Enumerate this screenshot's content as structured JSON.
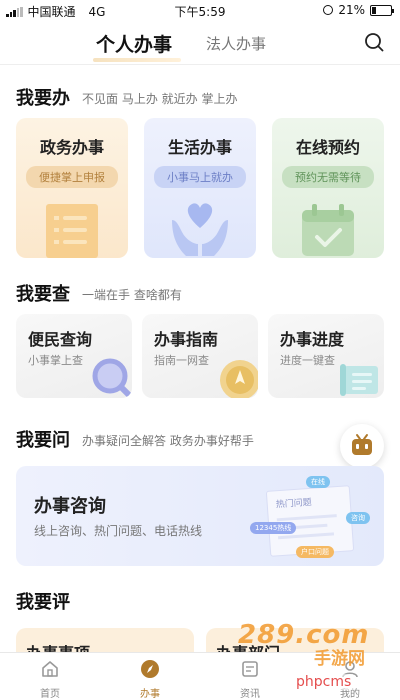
{
  "status_bar": {
    "carrier": "中国联通",
    "network": "4G",
    "time": "下午5:59",
    "battery": "21%",
    "battery_level": 0.21
  },
  "header": {
    "tab_active": "个人办事",
    "tab_other": "法人办事"
  },
  "section1": {
    "title": "我要办",
    "subtitle": "不见面 马上办 就近办 掌上办",
    "cards": [
      {
        "title": "政务办事",
        "pill": "便捷掌上申报"
      },
      {
        "title": "生活办事",
        "pill": "小事马上就办"
      },
      {
        "title": "在线预约",
        "pill": "预约无需等待"
      }
    ]
  },
  "section2": {
    "title": "我要查",
    "subtitle": "一端在手 查啥都有",
    "cards": [
      {
        "title": "便民查询",
        "sub": "小事掌上查"
      },
      {
        "title": "办事指南",
        "sub": "指南一网查"
      },
      {
        "title": "办事进度",
        "sub": "进度一键查"
      }
    ]
  },
  "section3": {
    "title": "我要问",
    "subtitle": "办事疑问全解答 政务办事好帮手",
    "banner": {
      "title": "办事咨询",
      "sub": "线上咨询、热门问题、电话热线",
      "doc_label": "热门问题",
      "tag1": "在线",
      "tag2": "咨询",
      "tag3": "12345热线",
      "tag4": "户口问题"
    }
  },
  "section4": {
    "title": "我要评",
    "cards": [
      {
        "title": "办事事项"
      },
      {
        "title": "办事部门"
      }
    ]
  },
  "nav": {
    "items": [
      {
        "label": "首页",
        "icon": "home-icon"
      },
      {
        "label": "办事",
        "icon": "compass-icon",
        "active": true
      },
      {
        "label": "资讯",
        "icon": "news-icon"
      },
      {
        "label": "我的",
        "icon": "user-icon"
      }
    ]
  },
  "watermark": {
    "text": "289.com",
    "sub": "手游网",
    "site": "phpcms"
  },
  "colors": {
    "accent": "#b07a2c",
    "orange_card": "#fdf1df",
    "blue_card": "#e9eefc",
    "green_card": "#e9f3e6"
  }
}
